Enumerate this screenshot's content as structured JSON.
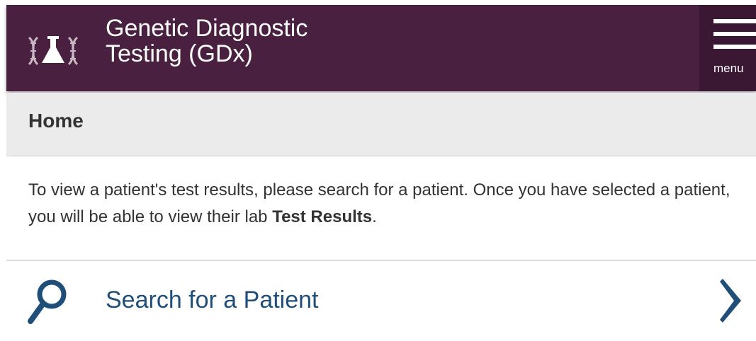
{
  "header": {
    "title_line1": "Genetic Diagnostic",
    "title_line2": "Testing (GDx)",
    "menu_label": "menu",
    "background_color": "#4a2040"
  },
  "breadcrumb": {
    "label": "Home"
  },
  "intro": {
    "text_before": "To view a patient's test results, please search for a patient. Once you have selected a patient, you will be able to view their lab ",
    "bold_text": "Test Results",
    "text_after": "."
  },
  "search": {
    "label": "Search for a Patient",
    "icon": "search-icon",
    "chevron_icon": "chevron-right-icon",
    "accent_color": "#1f4e79"
  }
}
